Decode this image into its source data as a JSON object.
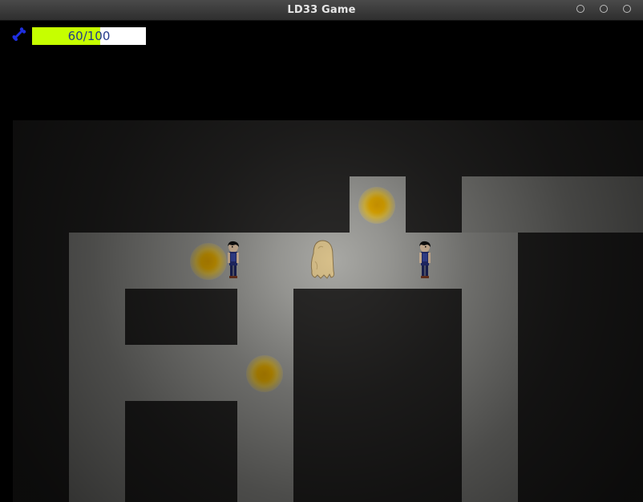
{
  "window": {
    "title": "LD33 Game",
    "buttons": [
      "minimize",
      "maximize",
      "close"
    ]
  },
  "hud": {
    "icon": "bone-icon",
    "health_text": "60/100",
    "health_current": 60,
    "health_max": 100,
    "health_fraction": 0.6,
    "bar_fill_color": "#c6ff00",
    "bar_bg_color": "#ffffff",
    "text_color": "#233a8c"
  },
  "world": {
    "floor_color": "#a8a8a4",
    "wall_color": "#2a2928",
    "entities": [
      {
        "type": "player-monster",
        "name": "ghost-monster"
      },
      {
        "type": "human",
        "name": "villager-left"
      },
      {
        "type": "human",
        "name": "villager-right"
      },
      {
        "type": "glowing-orb",
        "count": 3
      }
    ]
  }
}
